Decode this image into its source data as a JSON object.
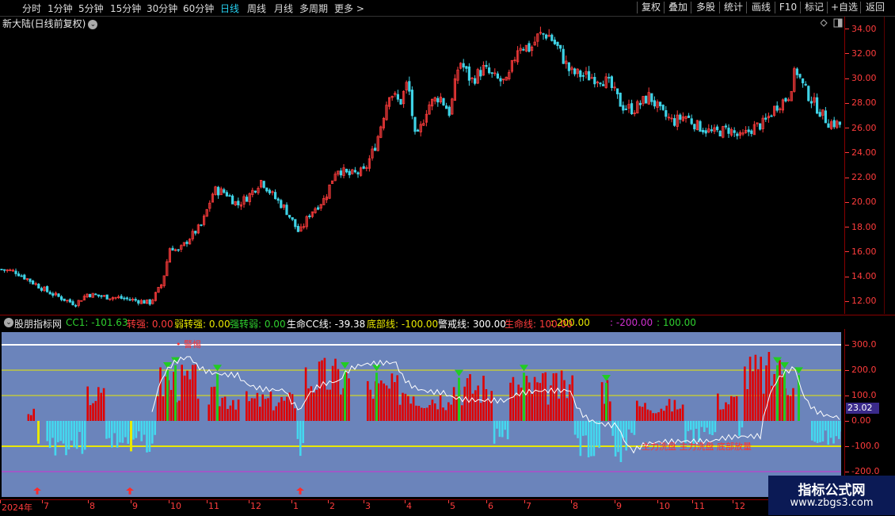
{
  "toolbar": {
    "periods": [
      "分时",
      "1分钟",
      "5分钟",
      "15分钟",
      "30分钟",
      "60分钟",
      "日线",
      "周线",
      "月线",
      "多周期",
      "更多 >"
    ],
    "active_period": "日线",
    "right_buttons": [
      "复权",
      "叠加",
      "多股",
      "统计",
      "画线",
      "F10",
      "标记",
      "+自选",
      "返回"
    ]
  },
  "main_chart": {
    "title": "新大陆(日线前复权)",
    "price_ticks": [
      "34.00",
      "32.00",
      "30.00",
      "28.00",
      "26.00",
      "24.00",
      "22.00",
      "20.00",
      "18.00",
      "16.00",
      "14.00",
      "12.00"
    ],
    "up_color": "#ff3c3c",
    "down_color": "#3fd3e6"
  },
  "indicator": {
    "name": "股朋指标网",
    "items": [
      {
        "label": "CC1: -101.63",
        "color": "#2fd02f"
      },
      {
        "label": "转强: 0.00",
        "color": "#ff3c3c"
      },
      {
        "label": "弱转强: 0.00",
        "color": "#e8e800"
      },
      {
        "label": "强转弱: 0.00",
        "color": "#2fd02f"
      },
      {
        "label": "生命CC线: -39.38",
        "color": "#ffffff"
      },
      {
        "label": "底部线: -100.00",
        "color": "#e8e800"
      },
      {
        "label": "警戒线: 300.00",
        "color": "#ffffff"
      },
      {
        "label": "生命线: 100.00",
        "color": "#ff3c3c"
      },
      {
        "label": ": 200.00",
        "color": "#e8e800"
      },
      {
        "label": ": -200.00",
        "color": "#d030d0"
      },
      {
        "label": ": 100.00",
        "color": "#2fd02f"
      }
    ],
    "axis_ticks": [
      "300.0",
      "200.0",
      "100.0",
      "0.00",
      "-100.0",
      "-200.0"
    ],
    "current_value": "23.02",
    "annotation_warn": "警惕",
    "annotation_bottom": "主力洗盘 主力洗盘 底部放量",
    "reference_lines": [
      {
        "value": 300,
        "color": "#ffffff"
      },
      {
        "value": 200,
        "color": "#e8e800"
      },
      {
        "value": 100,
        "color": "#e8e800"
      },
      {
        "value": -100,
        "color": "#e8e800"
      },
      {
        "value": -200,
        "color": "#d030d0"
      }
    ]
  },
  "date_axis": {
    "labels": [
      "2024年",
      "7",
      "8",
      "9",
      "10",
      "11",
      "12",
      "1",
      "2",
      "3",
      "4",
      "5",
      "6",
      "7",
      "8",
      "9",
      "10",
      "11",
      "12"
    ]
  },
  "watermark": {
    "line1": "指标公式网",
    "line2": "www.zbgs3.com"
  },
  "chart_data": {
    "type": "candlestick",
    "ylim": [
      11,
      35
    ],
    "indicator_ylim": [
      -300,
      350
    ],
    "close_path": [
      {
        "t": 0,
        "p": 14.6
      },
      {
        "t": 20,
        "p": 14.4
      },
      {
        "t": 40,
        "p": 13.6
      },
      {
        "t": 60,
        "p": 12.8
      },
      {
        "t": 80,
        "p": 12.2
      },
      {
        "t": 95,
        "p": 11.8
      },
      {
        "t": 110,
        "p": 12.6
      },
      {
        "t": 130,
        "p": 12.4
      },
      {
        "t": 150,
        "p": 12.3
      },
      {
        "t": 170,
        "p": 12.1
      },
      {
        "t": 190,
        "p": 11.9
      },
      {
        "t": 205,
        "p": 13.5
      },
      {
        "t": 215,
        "p": 16.5
      },
      {
        "t": 225,
        "p": 16.0
      },
      {
        "t": 240,
        "p": 17.2
      },
      {
        "t": 255,
        "p": 18.2
      },
      {
        "t": 270,
        "p": 21.0
      },
      {
        "t": 285,
        "p": 20.8
      },
      {
        "t": 300,
        "p": 19.8
      },
      {
        "t": 315,
        "p": 20.6
      },
      {
        "t": 330,
        "p": 21.8
      },
      {
        "t": 345,
        "p": 20.5
      },
      {
        "t": 360,
        "p": 19.5
      },
      {
        "t": 378,
        "p": 17.5
      },
      {
        "t": 392,
        "p": 19.2
      },
      {
        "t": 410,
        "p": 20.3
      },
      {
        "t": 425,
        "p": 22.8
      },
      {
        "t": 440,
        "p": 22.2
      },
      {
        "t": 460,
        "p": 22.5
      },
      {
        "t": 475,
        "p": 24.8
      },
      {
        "t": 492,
        "p": 29.0
      },
      {
        "t": 505,
        "p": 28.0
      },
      {
        "t": 515,
        "p": 29.8
      },
      {
        "t": 525,
        "p": 24.8
      },
      {
        "t": 540,
        "p": 27.8
      },
      {
        "t": 555,
        "p": 28.6
      },
      {
        "t": 568,
        "p": 27.2
      },
      {
        "t": 580,
        "p": 31.5
      },
      {
        "t": 595,
        "p": 29.8
      },
      {
        "t": 610,
        "p": 30.8
      },
      {
        "t": 625,
        "p": 30.0
      },
      {
        "t": 640,
        "p": 29.6
      },
      {
        "t": 655,
        "p": 32.8
      },
      {
        "t": 670,
        "p": 32.4
      },
      {
        "t": 680,
        "p": 33.5
      },
      {
        "t": 692,
        "p": 33.6
      },
      {
        "t": 705,
        "p": 32.4
      },
      {
        "t": 720,
        "p": 30.5
      },
      {
        "t": 740,
        "p": 30.2
      },
      {
        "t": 760,
        "p": 30.0
      },
      {
        "t": 770,
        "p": 29.5
      },
      {
        "t": 785,
        "p": 27.8
      },
      {
        "t": 800,
        "p": 27.5
      },
      {
        "t": 820,
        "p": 28.6
      },
      {
        "t": 835,
        "p": 27.2
      },
      {
        "t": 850,
        "p": 26.5
      },
      {
        "t": 865,
        "p": 27.0
      },
      {
        "t": 880,
        "p": 26.2
      },
      {
        "t": 900,
        "p": 25.6
      },
      {
        "t": 920,
        "p": 25.9
      },
      {
        "t": 935,
        "p": 25.2
      },
      {
        "t": 950,
        "p": 26.0
      },
      {
        "t": 965,
        "p": 26.4
      },
      {
        "t": 980,
        "p": 27.8
      },
      {
        "t": 995,
        "p": 28.5
      },
      {
        "t": 1005,
        "p": 30.8
      },
      {
        "t": 1015,
        "p": 29.2
      },
      {
        "t": 1030,
        "p": 27.8
      },
      {
        "t": 1045,
        "p": 26.5
      },
      {
        "t": 1060,
        "p": 26.3
      }
    ]
  }
}
